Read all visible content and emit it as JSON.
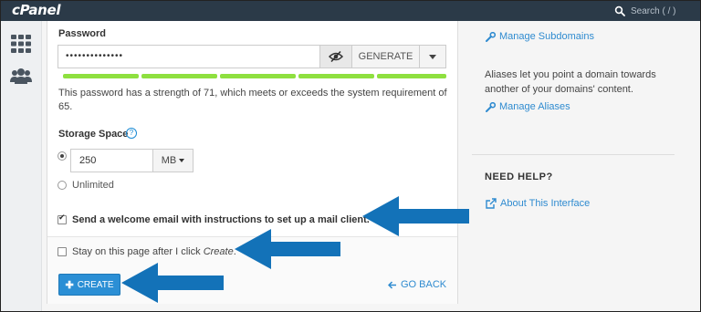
{
  "app": {
    "logo": "cPanel"
  },
  "search": {
    "placeholder": "Search ( / )"
  },
  "sidebar": {
    "icons": [
      "grid-icon",
      "users-icon"
    ]
  },
  "form": {
    "password_label": "Password",
    "password_value": "••••••••••••••",
    "generate_label": "GENERATE",
    "strength_text": "This password has a strength of 71, which meets or exceeds the system requirement of 65.",
    "storage_label": "Storage Space",
    "storage_value": "250",
    "storage_unit": "MB",
    "unlimited_label": "Unlimited",
    "welcome_email_label": "Send a welcome email with instructions to set up a mail client.",
    "stay_label_prefix": "Stay on this page after I click ",
    "stay_label_emph": "Create",
    "stay_label_suffix": ".",
    "create_label": "CREATE",
    "go_back_label": "GO BACK"
  },
  "right": {
    "manage_subdomains": "Manage Subdomains",
    "aliases_text": "Aliases let you point a domain towards another of your domains' content.",
    "manage_aliases": "Manage Aliases",
    "need_help": "NEED HELP?",
    "about_interface": "About This Interface"
  },
  "colors": {
    "topbar": "#2b3a48",
    "accent": "#2b8fd5",
    "link": "#2f8bd0",
    "strength": "#8ee03f",
    "arrow": "#1372b8"
  }
}
